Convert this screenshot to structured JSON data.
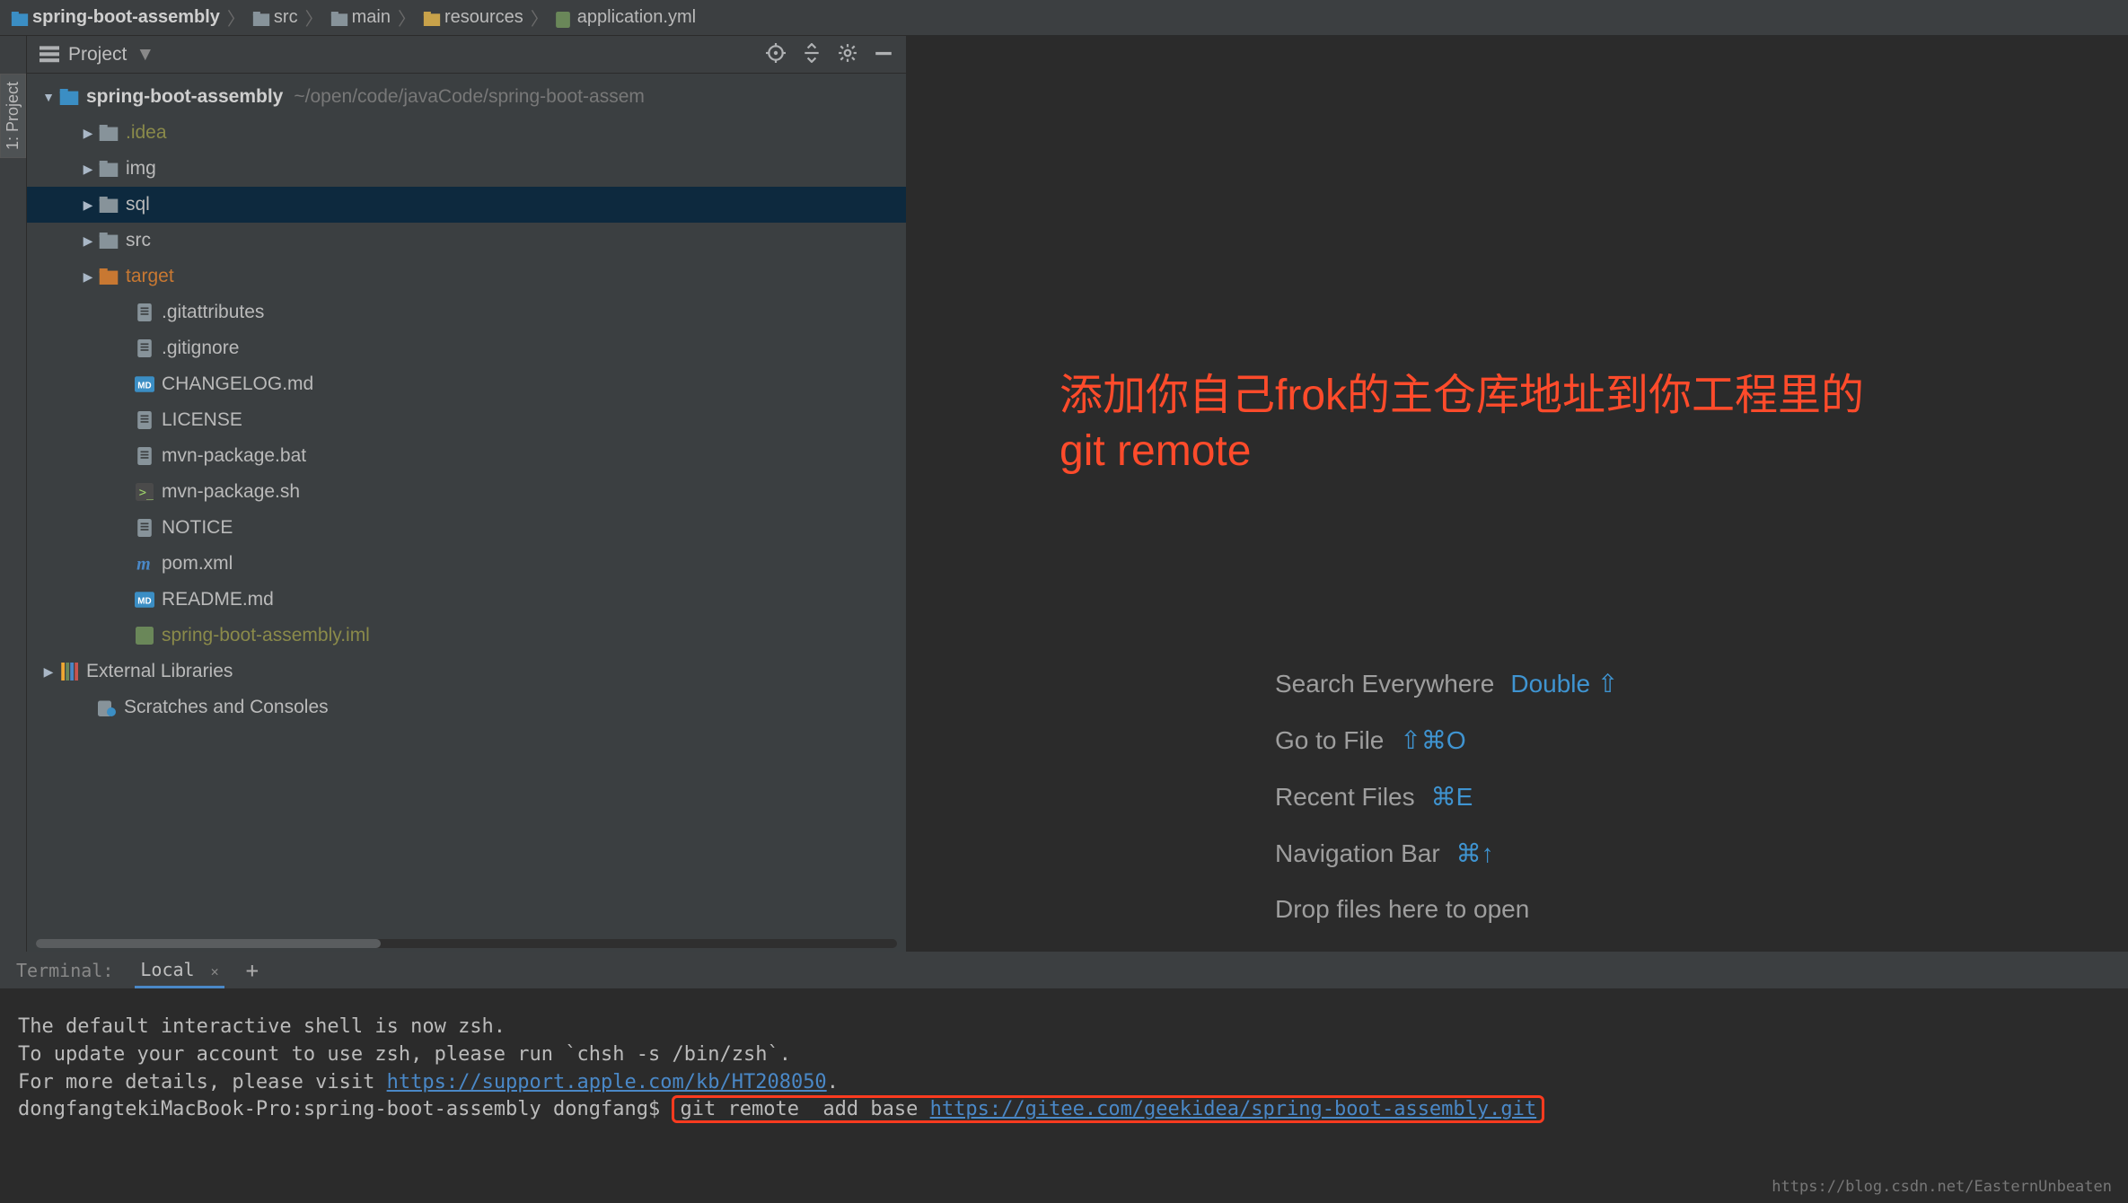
{
  "breadcrumbs": [
    {
      "icon": "folder-module",
      "label": "spring-boot-assembly"
    },
    {
      "icon": "folder",
      "label": "src"
    },
    {
      "icon": "folder",
      "label": "main"
    },
    {
      "icon": "folder-res",
      "label": "resources"
    },
    {
      "icon": "yml",
      "label": "application.yml"
    }
  ],
  "left_gutter_tab": "1: Project",
  "project_panel": {
    "title": "Project",
    "toolbar": [
      "locate",
      "collapse",
      "settings",
      "hide"
    ]
  },
  "tree": [
    {
      "depth": 0,
      "arrow": "down",
      "icon": "folder-module",
      "label": "spring-boot-assembly",
      "label_class": "bold",
      "extra": "~/open/code/javaCode/spring-boot-assem",
      "selected": false
    },
    {
      "depth": 1,
      "arrow": "right",
      "icon": "folder",
      "label": ".idea",
      "label_class": "olive",
      "selected": false
    },
    {
      "depth": 1,
      "arrow": "right",
      "icon": "folder",
      "label": "img",
      "selected": false
    },
    {
      "depth": 1,
      "arrow": "right",
      "icon": "folder",
      "label": "sql",
      "selected": true
    },
    {
      "depth": 1,
      "arrow": "right",
      "icon": "folder",
      "label": "src",
      "selected": false
    },
    {
      "depth": 1,
      "arrow": "right",
      "icon": "folder-orange",
      "label": "target",
      "label_class": "orange",
      "selected": false
    },
    {
      "depth": 2,
      "arrow": "none",
      "icon": "file",
      "label": ".gitattributes",
      "selected": false
    },
    {
      "depth": 2,
      "arrow": "none",
      "icon": "file",
      "label": ".gitignore",
      "selected": false
    },
    {
      "depth": 2,
      "arrow": "none",
      "icon": "md",
      "label": "CHANGELOG.md",
      "selected": false
    },
    {
      "depth": 2,
      "arrow": "none",
      "icon": "file",
      "label": "LICENSE",
      "selected": false
    },
    {
      "depth": 2,
      "arrow": "none",
      "icon": "file",
      "label": "mvn-package.bat",
      "selected": false
    },
    {
      "depth": 2,
      "arrow": "none",
      "icon": "sh",
      "label": "mvn-package.sh",
      "selected": false
    },
    {
      "depth": 2,
      "arrow": "none",
      "icon": "file",
      "label": "NOTICE",
      "selected": false
    },
    {
      "depth": 2,
      "arrow": "none",
      "icon": "maven",
      "label": "pom.xml",
      "selected": false
    },
    {
      "depth": 2,
      "arrow": "none",
      "icon": "md",
      "label": "README.md",
      "selected": false
    },
    {
      "depth": 2,
      "arrow": "none",
      "icon": "iml",
      "label": "spring-boot-assembly.iml",
      "label_class": "olive",
      "selected": false
    },
    {
      "depth": 0,
      "arrow": "right",
      "icon": "libs",
      "label": "External Libraries",
      "selected": false
    },
    {
      "depth": 0,
      "arrow": "none",
      "icon": "scratch",
      "label": "Scratches and Consoles",
      "selected": false,
      "pad": true
    }
  ],
  "annotation_line1": "添加你自己frok的主仓库地址到你工程里的",
  "annotation_line2": "git remote",
  "tips": [
    {
      "label": "Search Everywhere",
      "key": "Double ⇧"
    },
    {
      "label": "Go to File",
      "key": "⇧⌘O"
    },
    {
      "label": "Recent Files",
      "key": "⌘E"
    },
    {
      "label": "Navigation Bar",
      "key": "⌘↑"
    },
    {
      "label": "Drop files here to open",
      "key": ""
    }
  ],
  "terminal": {
    "label": "Terminal:",
    "tab": "Local",
    "lines": {
      "l1": "The default interactive shell is now zsh.",
      "l2": "To update your account to use zsh, please run `chsh -s /bin/zsh`.",
      "l3_pre": "For more details, please visit ",
      "l3_link": "https://support.apple.com/kb/HT208050",
      "l3_post": ".",
      "l4_prompt": "dongfangtekiMacBook-Pro:spring-boot-assembly dongfang$ ",
      "l4_cmd_pre": "git remote  add base ",
      "l4_cmd_link": "https://gitee.com/geekidea/spring-boot-assembly.git"
    }
  },
  "watermark": "https://blog.csdn.net/EasternUnbeaten"
}
